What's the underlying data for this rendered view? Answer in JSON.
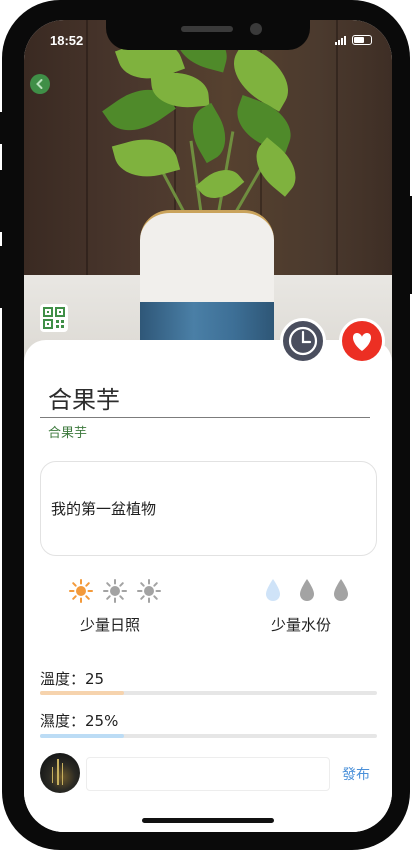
{
  "status_bar": {
    "time": "18:52"
  },
  "plant": {
    "name": "合果芋",
    "species": "合果芋",
    "note": "我的第一盆植物"
  },
  "care": {
    "light": {
      "label": "少量日照",
      "level": 1,
      "max": 3
    },
    "water": {
      "label": "少量水份",
      "level": 1,
      "max": 3
    }
  },
  "environment": {
    "temperature_label": "溫度：25",
    "temperature_fraction": 0.25,
    "humidity_label": "濕度：25%",
    "humidity_fraction": 0.25
  },
  "comment": {
    "placeholder": "",
    "post_label": "發布"
  },
  "icons": {
    "back": "back-arrow-icon",
    "qr": "qr-code-icon",
    "history": "clock-icon",
    "favorite": "heart-icon",
    "sun": "sun-icon",
    "drop": "water-drop-icon"
  },
  "colors": {
    "sun_active": "#f39a3b",
    "sun_inactive": "#a3a3a3",
    "drop_active": "#cfe3f8",
    "drop_inactive": "#a3a3a3",
    "temperature_bar": "#f6d3ad",
    "humidity_bar": "#bcdcf5",
    "favorite": "#ec2f23",
    "history": "#4a4e5e",
    "accent_green": "#3e7a3e",
    "link_blue": "#4a90d9"
  }
}
